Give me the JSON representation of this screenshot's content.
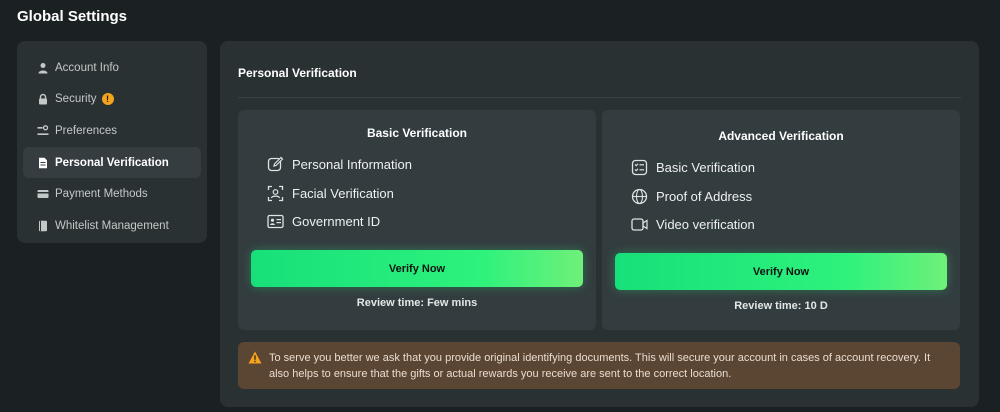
{
  "app": {
    "title": "Global Settings"
  },
  "sidebar": {
    "items": [
      {
        "label": "Account Info",
        "icon": "user-icon"
      },
      {
        "label": "Security",
        "icon": "lock-icon",
        "badge": "!"
      },
      {
        "label": "Preferences",
        "icon": "sliders-icon"
      },
      {
        "label": "Personal Verification",
        "icon": "document-icon",
        "active": true
      },
      {
        "label": "Payment Methods",
        "icon": "credit-card-icon"
      },
      {
        "label": "Whitelist Management",
        "icon": "book-icon"
      }
    ]
  },
  "main": {
    "title": "Personal Verification",
    "basic": {
      "title": "Basic Verification",
      "features": [
        {
          "label": "Personal Information",
          "icon": "edit-icon"
        },
        {
          "label": "Facial Verification",
          "icon": "face-scan-icon"
        },
        {
          "label": "Government ID",
          "icon": "id-card-icon"
        }
      ],
      "button": "Verify Now",
      "review": "Review time: Few mins"
    },
    "advanced": {
      "title": "Advanced Verification",
      "features": [
        {
          "label": "Basic Verification",
          "icon": "checklist-icon"
        },
        {
          "label": "Proof of Address",
          "icon": "globe-icon"
        },
        {
          "label": "Video verification",
          "icon": "video-icon"
        }
      ],
      "button": "Verify Now",
      "review": "Review time: 10 D"
    },
    "notice": {
      "text": "To serve you better we ask that you provide original identifying documents. This will secure your account in cases of account recovery. It also helps to ensure that the gifts or actual rewards you receive are sent to the correct location.",
      "icon": "warning-icon"
    }
  },
  "colors": {
    "background": "#1b2022",
    "panel": "#2a3133",
    "card": "#333c3f",
    "accent": "#2ef27c",
    "warning": "#f5a21c",
    "notice_bg": "#5b4634"
  }
}
